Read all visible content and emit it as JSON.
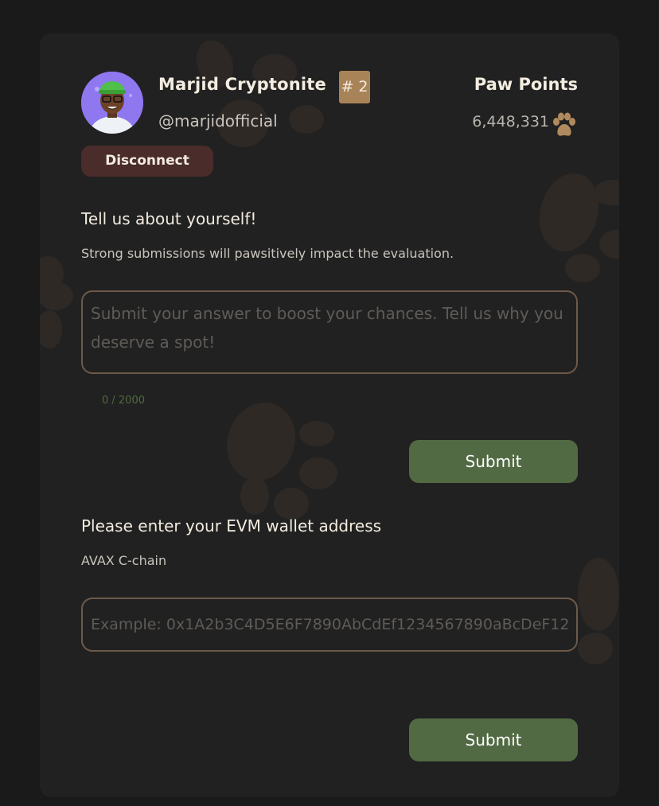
{
  "profile": {
    "name": "Marjid Cryptonite",
    "rank": "# 2",
    "handle": "@marjidofficial",
    "disconnect_label": "Disconnect"
  },
  "points": {
    "title": "Paw Points",
    "value": "6,448,331",
    "icon": "paw-icon"
  },
  "about": {
    "title": "Tell us about yourself!",
    "subtitle": "Strong submissions will pawsitively impact the evaluation.",
    "placeholder": "Submit your answer to boost your chances. Tell us why you deserve a spot!",
    "value": "",
    "counter": "0 / 2000",
    "submit_label": "Submit"
  },
  "wallet": {
    "title": "Please enter your EVM wallet address",
    "subtitle": "AVAX C-chain",
    "placeholder": "Example: 0x1A2b3C4D5E6F7890AbCdEf1234567890aBcDeF12",
    "value": "",
    "submit_label": "Submit"
  },
  "colors": {
    "background": "#1a1a1a",
    "card": "#212121",
    "accent_submit": "#526a44",
    "disconnect": "#4a2c2a",
    "rank_badge": "#a98358",
    "paw_icon": "#b08a5e",
    "input_border": "#6e5948",
    "text_primary": "#f3ece0"
  }
}
